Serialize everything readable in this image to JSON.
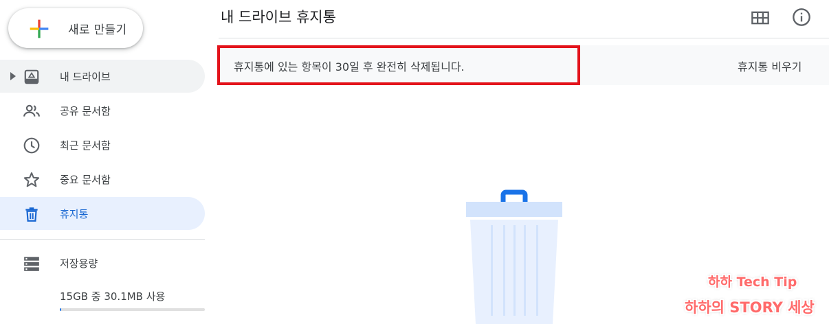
{
  "sidebar": {
    "new_button_label": "새로 만들기",
    "items": [
      {
        "key": "my-drive",
        "label": "내 드라이브",
        "icon": "drive-icon",
        "state": "hover",
        "expandable": true
      },
      {
        "key": "shared",
        "label": "공유 문서함",
        "icon": "people-icon",
        "state": "normal"
      },
      {
        "key": "recent",
        "label": "최근 문서함",
        "icon": "clock-icon",
        "state": "normal"
      },
      {
        "key": "starred",
        "label": "중요 문서함",
        "icon": "star-icon",
        "state": "normal"
      },
      {
        "key": "trash",
        "label": "휴지통",
        "icon": "trash-icon",
        "state": "active"
      },
      {
        "key": "storage",
        "label": "저장용량",
        "icon": "storage-icon",
        "state": "normal"
      }
    ],
    "storage": {
      "usage_text": "15GB 중 30.1MB 사용",
      "used_fraction": 0.002
    }
  },
  "header": {
    "title": "내 드라이브 휴지통",
    "icons": [
      "grid-view-icon",
      "info-icon"
    ]
  },
  "notice": {
    "text": "휴지통에 있는 항목이 30일 후 완전히 삭제됩니다.",
    "action_label": "휴지통 비우기"
  },
  "watermark": {
    "line1": "하하 Tech Tip",
    "line2": "하하의 STORY 세상"
  },
  "colors": {
    "accent": "#1a73e8",
    "active_bg": "#e8f0fe",
    "active_text": "#1967d2",
    "highlight_border": "#e3131b",
    "watermark": "#ff6a6a"
  }
}
